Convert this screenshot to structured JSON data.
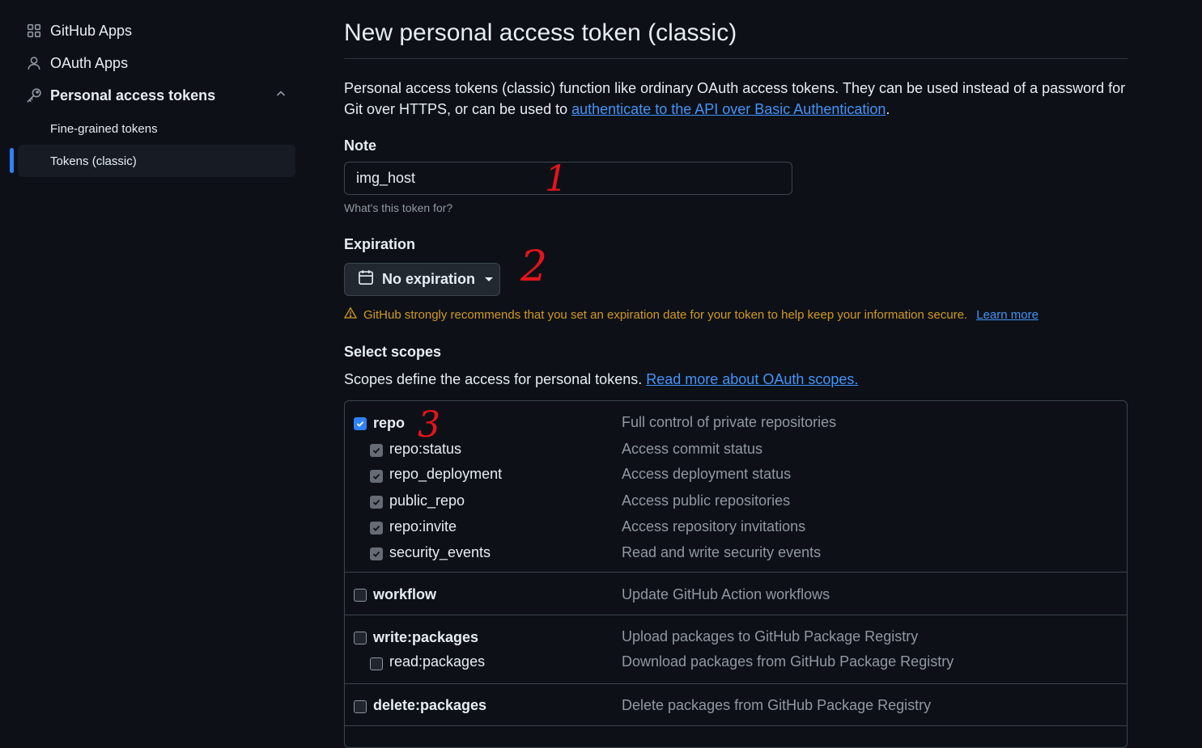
{
  "sidebar": {
    "items": [
      {
        "label": "GitHub Apps",
        "icon": "apps-grid-icon"
      },
      {
        "label": "OAuth Apps",
        "icon": "person-icon"
      },
      {
        "label": "Personal access tokens",
        "icon": "key-icon"
      }
    ],
    "subitems": [
      {
        "label": "Fine-grained tokens"
      },
      {
        "label": "Tokens (classic)",
        "active": true
      }
    ]
  },
  "page": {
    "title": "New personal access token (classic)",
    "intro_text": "Personal access tokens (classic) function like ordinary OAuth access tokens. They can be used instead of a password for Git over HTTPS, or can be used to ",
    "intro_link": "authenticate to the API over Basic Authentication",
    "intro_end": "."
  },
  "note": {
    "label": "Note",
    "value": "img_host",
    "hint": "What's this token for?"
  },
  "expiration": {
    "label": "Expiration",
    "value": "No expiration",
    "warning": "GitHub strongly recommends that you set an expiration date for your token to help keep your information secure.",
    "warning_link": "Learn more"
  },
  "scopes": {
    "label": "Select scopes",
    "desc": "Scopes define the access for personal tokens.",
    "desc_link": "Read more about OAuth scopes.",
    "repo": {
      "name": "repo",
      "desc": "Full control of private repositories",
      "checked": true
    },
    "repo_children": [
      {
        "name": "repo:status",
        "desc": "Access commit status"
      },
      {
        "name": "repo_deployment",
        "desc": "Access deployment status"
      },
      {
        "name": "public_repo",
        "desc": "Access public repositories"
      },
      {
        "name": "repo:invite",
        "desc": "Access repository invitations"
      },
      {
        "name": "security_events",
        "desc": "Read and write security events"
      }
    ],
    "workflow": {
      "name": "workflow",
      "desc": "Update GitHub Action workflows"
    },
    "write_packages": {
      "name": "write:packages",
      "desc": "Upload packages to GitHub Package Registry"
    },
    "read_packages": {
      "name": "read:packages",
      "desc": "Download packages from GitHub Package Registry"
    },
    "delete_packages": {
      "name": "delete:packages",
      "desc": "Delete packages from GitHub Package Registry"
    }
  },
  "annotations": [
    "1",
    "2",
    "3"
  ],
  "colors": {
    "background": "#0d1117",
    "accent": "#2f81f7",
    "link": "#4493f8",
    "warning": "#d29922",
    "annotation": "#e5141b"
  }
}
